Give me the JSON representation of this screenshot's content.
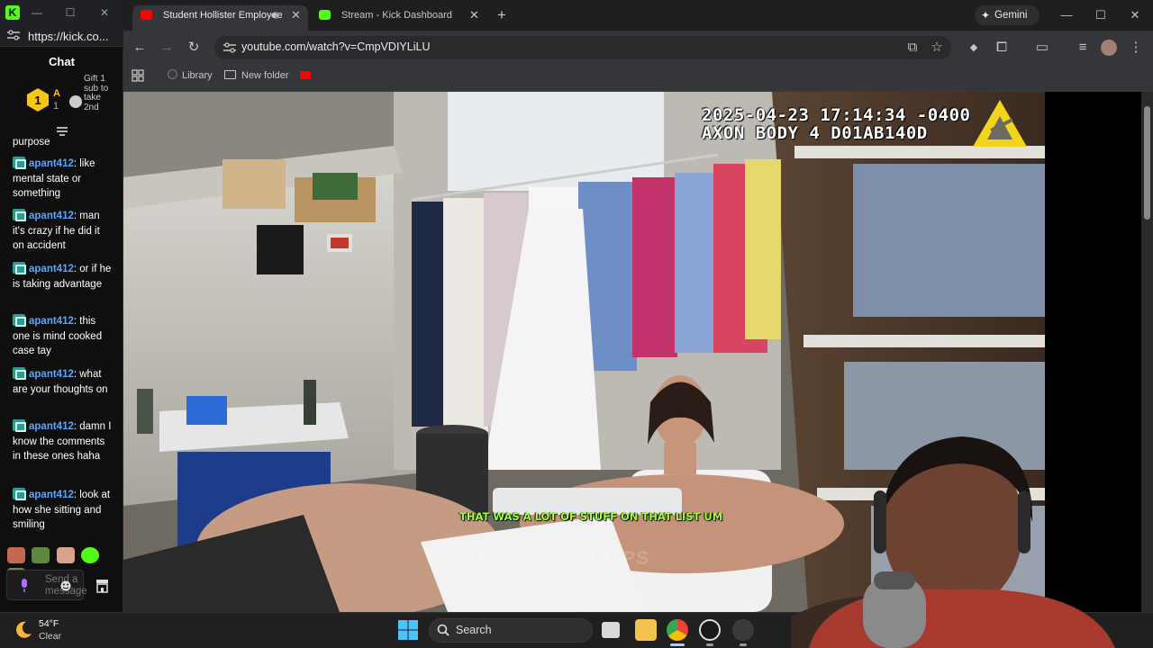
{
  "chat_window": {
    "url": "https://kick.co...",
    "header": "Chat",
    "sub_badge_number": "1",
    "sub_rank_letter": "A",
    "sub_rank_count": "1",
    "gift_text": "Gift 1 sub to take 2nd",
    "messages": [
      {
        "user": "",
        "text": "purpose"
      },
      {
        "user": "apant412",
        "text": ": like mental state or something"
      },
      {
        "user": "apant412",
        "text": ": man it's crazy if he did it on accident"
      },
      {
        "user": "apant412",
        "text": ": or if he is taking advantage"
      },
      {
        "user": "apant412",
        "text": ": this one is mind cooked case tay"
      },
      {
        "user": "apant412",
        "text": ": what are your thoughts on"
      },
      {
        "user": "apant412",
        "text": ": damn I know the comments in these ones haha"
      },
      {
        "user": "apant412",
        "text": ": look at how she sitting and smiling"
      }
    ],
    "input_placeholder": "Send a message"
  },
  "browser": {
    "tabs": [
      {
        "title": "Student Hollister Employee",
        "active": true,
        "favicon": "youtube-icon"
      },
      {
        "title": "Stream - Kick Dashboard",
        "active": false,
        "favicon": "kick-icon"
      }
    ],
    "gemini_label": "Gemini",
    "url": "youtube.com/watch?v=CmpVDIYLiLU",
    "bookmarks": [
      {
        "label": "Library",
        "icon": "circle-icon"
      },
      {
        "label": "New folder",
        "icon": "folder-icon"
      }
    ]
  },
  "video": {
    "timestamp_line1": "2025-04-23 17:14:34 -0400",
    "timestamp_line2": "AXON BODY 4 D01AB140D",
    "caption": "THAT WAS A LOT OF STUFF ON THAT LIST UM",
    "watermark": "BODYCAM CLIPS"
  },
  "taskbar": {
    "temperature": "54°F",
    "condition": "Clear",
    "search_label": "Search"
  },
  "colors": {
    "kick_green": "#53fc18",
    "chat_username": "#58a6ff",
    "caption_green": "#9cff3d",
    "youtube_red": "#ff0000"
  }
}
